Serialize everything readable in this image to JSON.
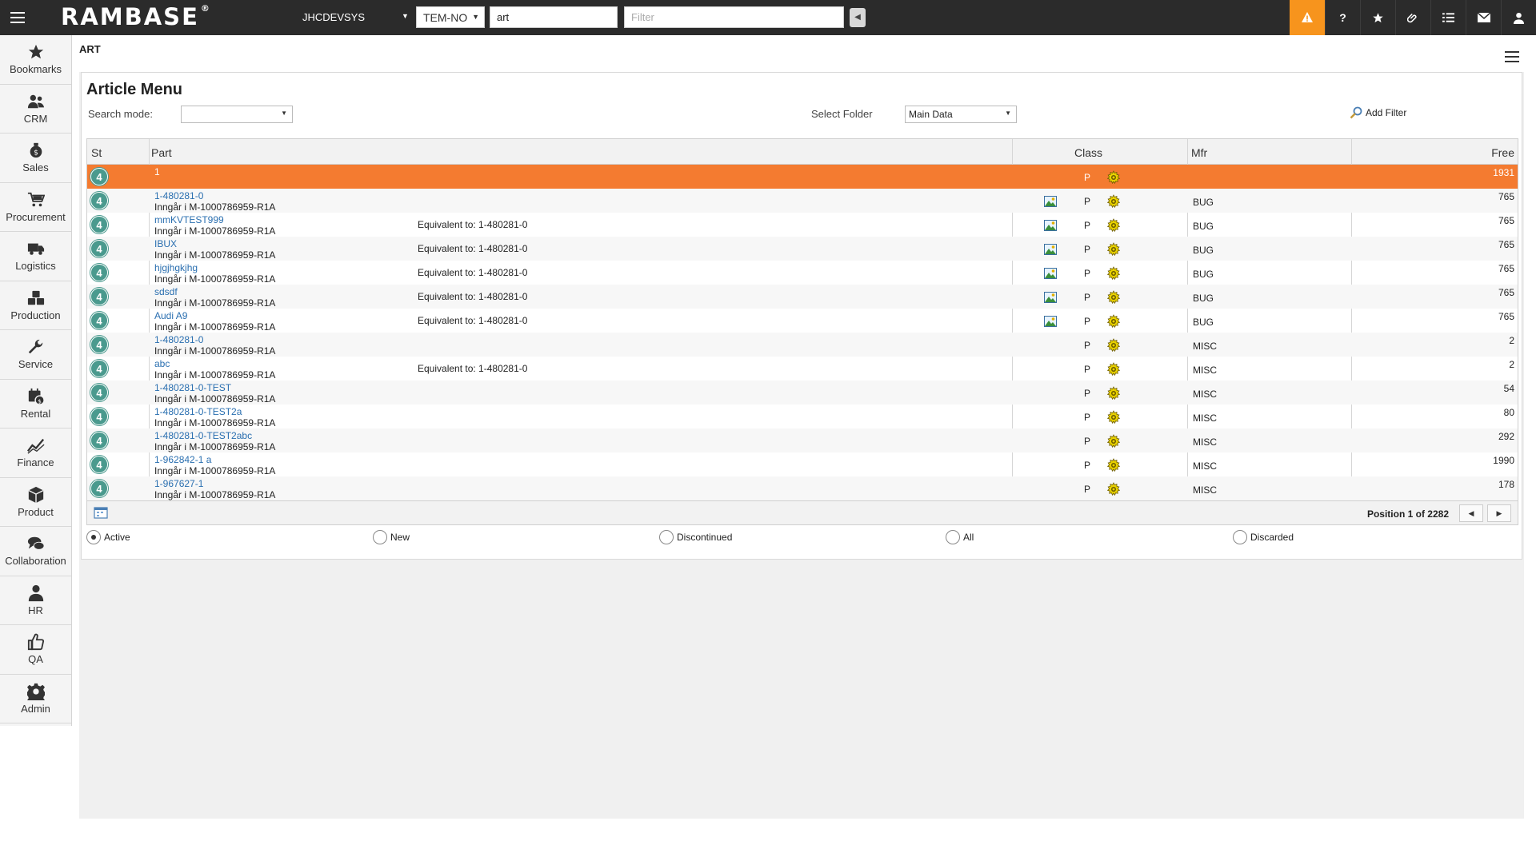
{
  "topbar": {
    "logo": "RAMBASE",
    "logo_mark": "®",
    "system": "JHCDEVSYS",
    "company": "TEM-NO",
    "search_value": "art",
    "filter_placeholder": "Filter",
    "icons": [
      "alert-icon",
      "help-icon",
      "star-icon",
      "paperclip-icon",
      "list-icon",
      "mail-icon",
      "user-icon"
    ]
  },
  "sidebar": {
    "items": [
      {
        "label": "Bookmarks",
        "icon": "star-icon"
      },
      {
        "label": "CRM",
        "icon": "people-icon"
      },
      {
        "label": "Sales",
        "icon": "money-bag-icon"
      },
      {
        "label": "Procurement",
        "icon": "cart-icon"
      },
      {
        "label": "Logistics",
        "icon": "truck-icon"
      },
      {
        "label": "Production",
        "icon": "boxes-icon"
      },
      {
        "label": "Service",
        "icon": "wrench-icon"
      },
      {
        "label": "Rental",
        "icon": "rental-icon"
      },
      {
        "label": "Finance",
        "icon": "chart-line-icon"
      },
      {
        "label": "Product",
        "icon": "cube-icon"
      },
      {
        "label": "Collaboration",
        "icon": "chat-icon"
      },
      {
        "label": "HR",
        "icon": "person-icon"
      },
      {
        "label": "QA",
        "icon": "thumbs-up-icon"
      },
      {
        "label": "Admin",
        "icon": "gear-icon"
      }
    ]
  },
  "main": {
    "breadcrumb": "ART",
    "title": "Article Menu",
    "search_mode_label": "Search mode:",
    "search_mode_value": "",
    "select_folder_label": "Select Folder",
    "select_folder_value": "Main Data",
    "add_filter_label": "Add Filter"
  },
  "grid": {
    "columns": {
      "st": "St",
      "part": "Part",
      "class": "Class",
      "mfr": "Mfr",
      "free": "Free"
    },
    "rows": [
      {
        "st": "4",
        "name": "1",
        "desc": "",
        "equiv": "",
        "img": false,
        "cls": "P",
        "mfr": "",
        "free": "1931",
        "selected": true
      },
      {
        "st": "4",
        "name": "1-480281-0",
        "desc": "Inngår i M-1000786959-R1A",
        "equiv": "",
        "img": true,
        "cls": "P",
        "mfr": "BUG",
        "free": "765"
      },
      {
        "st": "4",
        "name": "mmKVTEST999",
        "desc": "Inngår i M-1000786959-R1A",
        "equiv": "Equivalent to: 1-480281-0",
        "img": true,
        "cls": "P",
        "mfr": "BUG",
        "free": "765"
      },
      {
        "st": "4",
        "name": "IBUX",
        "desc": "Inngår i M-1000786959-R1A",
        "equiv": "Equivalent to: 1-480281-0",
        "img": true,
        "cls": "P",
        "mfr": "BUG",
        "free": "765"
      },
      {
        "st": "4",
        "name": "hjgjhgkjhg",
        "desc": "Inngår i M-1000786959-R1A",
        "equiv": "Equivalent to: 1-480281-0",
        "img": true,
        "cls": "P",
        "mfr": "BUG",
        "free": "765"
      },
      {
        "st": "4",
        "name": "sdsdf",
        "desc": "Inngår i M-1000786959-R1A",
        "equiv": "Equivalent to: 1-480281-0",
        "img": true,
        "cls": "P",
        "mfr": "BUG",
        "free": "765"
      },
      {
        "st": "4",
        "name": "Audi A9",
        "desc": "Inngår i M-1000786959-R1A",
        "equiv": "Equivalent to: 1-480281-0",
        "img": true,
        "cls": "P",
        "mfr": "BUG",
        "free": "765"
      },
      {
        "st": "4",
        "name": "1-480281-0",
        "desc": "Inngår i M-1000786959-R1A",
        "equiv": "",
        "img": false,
        "cls": "P",
        "mfr": "MISC",
        "free": "2"
      },
      {
        "st": "4",
        "name": "abc",
        "desc": "Inngår i M-1000786959-R1A",
        "equiv": "Equivalent to: 1-480281-0",
        "img": false,
        "cls": "P",
        "mfr": "MISC",
        "free": "2"
      },
      {
        "st": "4",
        "name": "1-480281-0-TEST",
        "desc": "Inngår i M-1000786959-R1A",
        "equiv": "",
        "img": false,
        "cls": "P",
        "mfr": "MISC",
        "free": "54"
      },
      {
        "st": "4",
        "name": "1-480281-0-TEST2a",
        "desc": "Inngår i M-1000786959-R1A",
        "equiv": "",
        "img": false,
        "cls": "P",
        "mfr": "MISC",
        "free": "80"
      },
      {
        "st": "4",
        "name": "1-480281-0-TEST2abc",
        "desc": "Inngår i M-1000786959-R1A",
        "equiv": "",
        "img": false,
        "cls": "P",
        "mfr": "MISC",
        "free": "292"
      },
      {
        "st": "4",
        "name": "1-962842-1 a",
        "desc": "Inngår i M-1000786959-R1A",
        "equiv": "",
        "img": false,
        "cls": "P",
        "mfr": "MISC",
        "free": "1990"
      },
      {
        "st": "4",
        "name": "1-967627-1",
        "desc": "Inngår i M-1000786959-R1A",
        "equiv": "",
        "img": false,
        "cls": "P",
        "mfr": "MISC",
        "free": "178"
      }
    ],
    "position_text": "Position 1 of 2282"
  },
  "status_filters": [
    {
      "label": "Active",
      "checked": true
    },
    {
      "label": "New",
      "checked": false
    },
    {
      "label": "Discontinued",
      "checked": false
    },
    {
      "label": "All",
      "checked": false
    },
    {
      "label": "Discarded",
      "checked": false
    }
  ],
  "colors": {
    "topbar_bg": "#2b2b2b",
    "alert_orange": "#f7941d",
    "selected_row": "#f47b30",
    "status_badge": "#4a9a8e",
    "link_blue": "#2a6fb0"
  }
}
